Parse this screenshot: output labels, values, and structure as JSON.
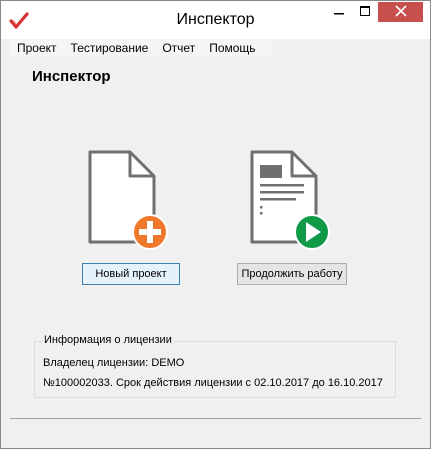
{
  "window": {
    "title": "Инспектор",
    "colors": {
      "close_button": "#c7504c",
      "icon_orange": "#f0782d",
      "icon_green": "#109a48",
      "doc_gray": "#6f6f6f"
    }
  },
  "titlebar": {
    "app_icon": "red-check-icon",
    "minimize_icon": "minimize-icon",
    "maximize_icon": "maximize-icon",
    "close_icon": "close-icon"
  },
  "menu": {
    "items": [
      "Проект",
      "Тестирование",
      "Отчет",
      "Помощь"
    ]
  },
  "main": {
    "heading": "Инспектор",
    "new_project_icon": "new-document-plus-icon",
    "continue_icon": "document-play-icon",
    "new_project_label": "Новый проект",
    "continue_label": "Продолжить работу"
  },
  "license": {
    "legend": "Информация о лицензии",
    "owner": "Владелец лицензии: DEMO",
    "validity": "№100002033. Срок действия лицензии с 02.10.2017 до 16.10.2017"
  }
}
